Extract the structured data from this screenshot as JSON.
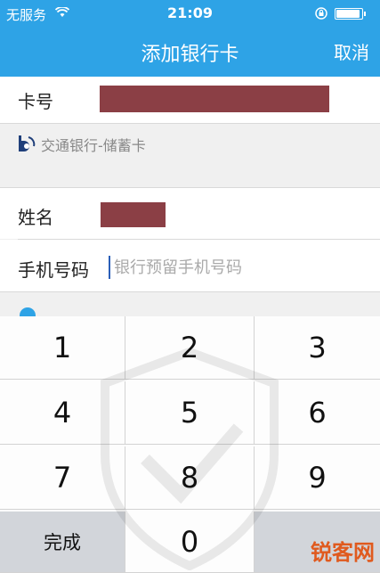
{
  "status_bar": {
    "carrier": "无服务",
    "time": "21:09",
    "icons": [
      "wifi-icon",
      "lock-rotation-icon",
      "battery-icon"
    ]
  },
  "header": {
    "title": "添加银行卡",
    "cancel_label": "取消",
    "background": "#2ea3e6"
  },
  "form": {
    "card_number_label": "卡号",
    "bank_name": "交通银行-储蓄卡",
    "name_label": "姓名",
    "phone_label": "手机号码",
    "phone_value": "",
    "phone_placeholder": "银行预留手机号码",
    "redaction_color": "#8b3f45"
  },
  "agreement": {
    "icon": "checkbox-icon"
  },
  "keypad": {
    "keys": [
      "1",
      "2",
      "3",
      "4",
      "5",
      "6",
      "7",
      "8",
      "9",
      "完成",
      "0",
      ""
    ]
  },
  "watermark": {
    "text": "锐客网"
  }
}
